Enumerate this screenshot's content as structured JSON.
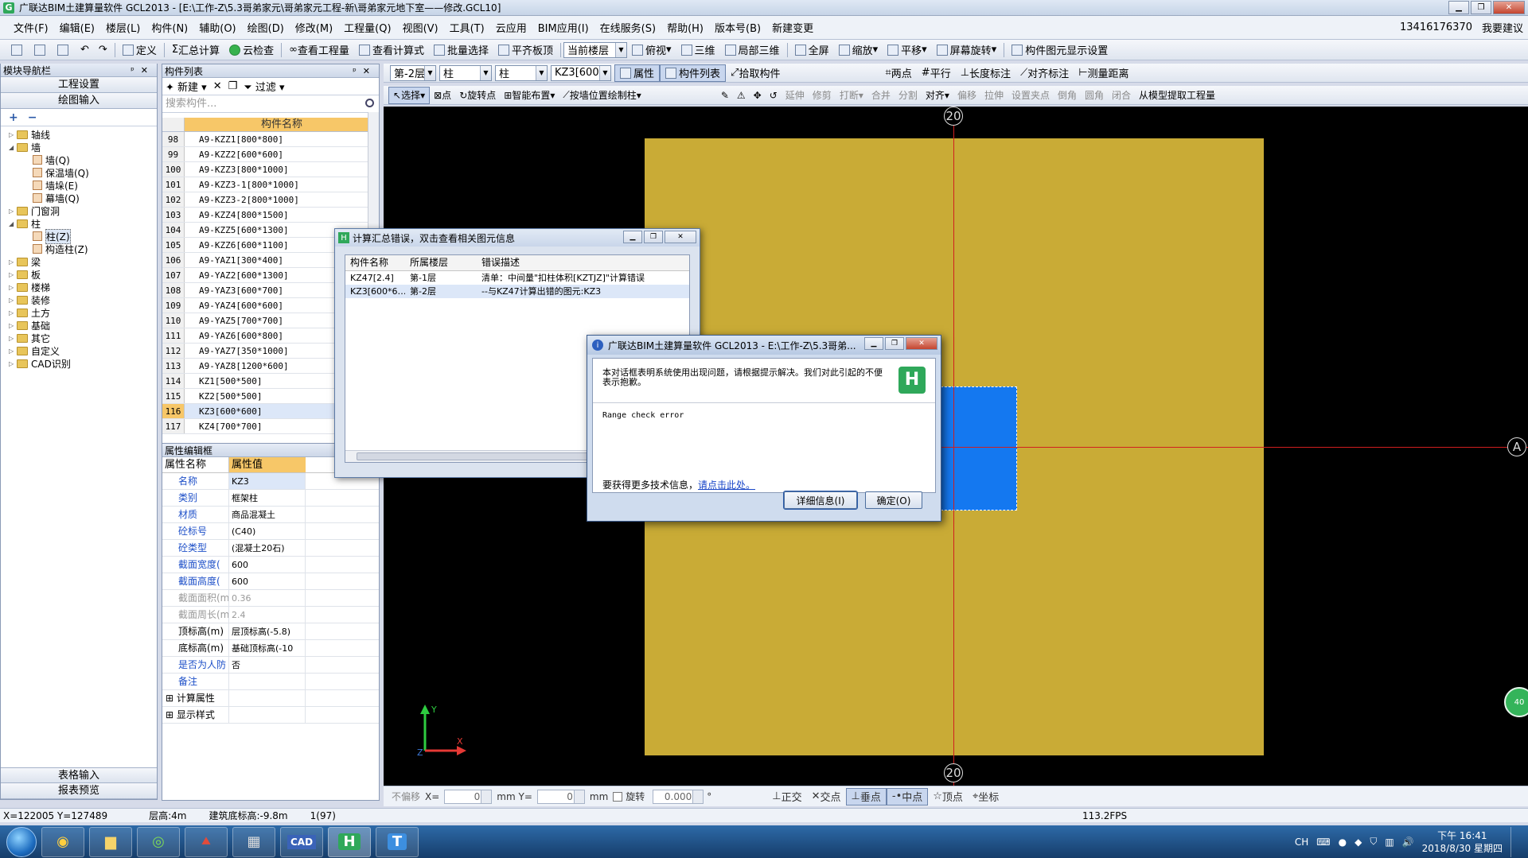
{
  "window": {
    "title": "广联达BIM土建算量软件 GCL2013 - [E:\\工作-Z\\5.3哥弟家元\\哥弟家元工程-新\\哥弟家元地下室——修改.GCL10]",
    "app_icon": "G"
  },
  "menu": [
    "文件(F)",
    "编辑(E)",
    "楼层(L)",
    "构件(N)",
    "辅助(O)",
    "绘图(D)",
    "修改(M)",
    "工程量(Q)",
    "视图(V)",
    "工具(T)",
    "云应用",
    "BIM应用(I)",
    "在线服务(S)",
    "帮助(H)",
    "版本号(B)",
    "新建变更"
  ],
  "account": {
    "phone": "13416176370",
    "suggest": "我要建议"
  },
  "toolbar1": [
    "定义",
    "汇总计算",
    "云检查",
    "查看工程量",
    "查看计算式",
    "批量选择",
    "平齐板顶",
    "当前楼层",
    "俯视",
    "三维",
    "局部三维",
    "全屏",
    "缩放",
    "平移",
    "屏幕旋转",
    "构件图元显示设置"
  ],
  "leftnav": {
    "title": "模块导航栏",
    "top_buttons": [
      "工程设置",
      "绘图输入"
    ],
    "tree": [
      {
        "label": "轴线",
        "level": 0,
        "type": "folder",
        "exp": "▷"
      },
      {
        "label": "墙",
        "level": 0,
        "type": "folder",
        "exp": "◢"
      },
      {
        "label": "墙(Q)",
        "level": 1,
        "type": "leaf"
      },
      {
        "label": "保温墙(Q)",
        "level": 1,
        "type": "leaf"
      },
      {
        "label": "墙垛(E)",
        "level": 1,
        "type": "leaf"
      },
      {
        "label": "幕墙(Q)",
        "level": 1,
        "type": "leaf"
      },
      {
        "label": "门窗洞",
        "level": 0,
        "type": "folder",
        "exp": "▷"
      },
      {
        "label": "柱",
        "level": 0,
        "type": "folder",
        "exp": "◢"
      },
      {
        "label": "柱(Z)",
        "level": 1,
        "type": "leaf",
        "selected": true
      },
      {
        "label": "构造柱(Z)",
        "level": 1,
        "type": "leaf"
      },
      {
        "label": "梁",
        "level": 0,
        "type": "folder",
        "exp": "▷"
      },
      {
        "label": "板",
        "level": 0,
        "type": "folder",
        "exp": "▷"
      },
      {
        "label": "楼梯",
        "level": 0,
        "type": "folder",
        "exp": "▷"
      },
      {
        "label": "装修",
        "level": 0,
        "type": "folder",
        "exp": "▷"
      },
      {
        "label": "土方",
        "level": 0,
        "type": "folder",
        "exp": "▷"
      },
      {
        "label": "基础",
        "level": 0,
        "type": "folder",
        "exp": "▷"
      },
      {
        "label": "其它",
        "level": 0,
        "type": "folder",
        "exp": "▷"
      },
      {
        "label": "自定义",
        "level": 0,
        "type": "folder",
        "exp": "▷"
      },
      {
        "label": "CAD识别",
        "level": 0,
        "type": "folder",
        "exp": "▷"
      }
    ],
    "bottom_buttons": [
      "表格输入",
      "报表预览"
    ]
  },
  "complist": {
    "title": "构件列表",
    "tools": [
      "新建",
      "过滤"
    ],
    "search_placeholder": "搜索构件...",
    "column": "构件名称",
    "rows": [
      {
        "num": "98",
        "name": "A9-KZZ1[800*800]"
      },
      {
        "num": "99",
        "name": "A9-KZZ2[600*600]"
      },
      {
        "num": "100",
        "name": "A9-KZZ3[800*1000]"
      },
      {
        "num": "101",
        "name": "A9-KZZ3-1[800*1000]"
      },
      {
        "num": "102",
        "name": "A9-KZZ3-2[800*1000]"
      },
      {
        "num": "103",
        "name": "A9-KZZ4[800*1500]"
      },
      {
        "num": "104",
        "name": "A9-KZZ5[600*1300]"
      },
      {
        "num": "105",
        "name": "A9-KZZ6[600*1100]"
      },
      {
        "num": "106",
        "name": "A9-YAZ1[300*400]"
      },
      {
        "num": "107",
        "name": "A9-YAZ2[600*1300]"
      },
      {
        "num": "108",
        "name": "A9-YAZ3[600*700]"
      },
      {
        "num": "109",
        "name": "A9-YAZ4[600*600]"
      },
      {
        "num": "110",
        "name": "A9-YAZ5[700*700]"
      },
      {
        "num": "111",
        "name": "A9-YAZ6[600*800]"
      },
      {
        "num": "112",
        "name": "A9-YAZ7[350*1000]"
      },
      {
        "num": "113",
        "name": "A9-YAZ8[1200*600]"
      },
      {
        "num": "114",
        "name": "KZ1[500*500]"
      },
      {
        "num": "115",
        "name": "KZ2[500*500]"
      },
      {
        "num": "116",
        "name": "KZ3[600*600]",
        "selected": true
      },
      {
        "num": "117",
        "name": "KZ4[700*700]"
      }
    ]
  },
  "propedit": {
    "title": "属性编辑框",
    "col_name": "属性名称",
    "col_value": "属性值",
    "rows": [
      {
        "name": "名称",
        "value": "KZ3",
        "style": "blue",
        "hl": true
      },
      {
        "name": "类别",
        "value": "框架柱",
        "style": "blue"
      },
      {
        "name": "材质",
        "value": "商品混凝土",
        "style": "blue"
      },
      {
        "name": "砼标号",
        "value": "(C40)",
        "style": "blue"
      },
      {
        "name": "砼类型",
        "value": "(混凝土20石)",
        "style": "blue"
      },
      {
        "name": "截面宽度(",
        "value": "600",
        "style": "blue"
      },
      {
        "name": "截面高度(",
        "value": "600",
        "style": "blue"
      },
      {
        "name": "截面面积(m",
        "value": "0.36",
        "style": "gray"
      },
      {
        "name": "截面周长(m",
        "value": "2.4",
        "style": "gray"
      },
      {
        "name": "顶标高(m)",
        "value": "层顶标高(-5.8)",
        "style": ""
      },
      {
        "name": "底标高(m)",
        "value": "基础顶标高(-10",
        "style": ""
      },
      {
        "name": "是否为人防",
        "value": "否",
        "style": "blue"
      },
      {
        "name": "备注",
        "value": "",
        "style": "blue"
      },
      {
        "name": "计算属性",
        "value": "",
        "style": "expand"
      },
      {
        "name": "显示样式",
        "value": "",
        "style": "expand"
      }
    ]
  },
  "drawtb": {
    "floor": "第-2层",
    "type1": "柱",
    "type2": "柱",
    "component": "KZ3[600*",
    "items": [
      "属性",
      "构件列表",
      "拾取构件",
      "两点",
      "平行",
      "长度标注",
      "对齐标注",
      "测量距离"
    ]
  },
  "drawtb2": [
    "选择",
    "点",
    "旋转点",
    "智能布置",
    "按墙位置绘制柱",
    "延伸",
    "修剪",
    "打断",
    "合并",
    "分割",
    "对齐",
    "偏移",
    "拉伸",
    "设置夹点",
    "倒角",
    "圆角",
    "闭合",
    "从模型提取工程量"
  ],
  "canvas": {
    "axis_top": "20",
    "axis_bottom": "20",
    "axis_right": "A",
    "bubble_badge": "40"
  },
  "coordbar": {
    "offset": "不偏移",
    "x_label": "X=",
    "x_val": "0",
    "y_label": "mm Y=",
    "y_val": "0",
    "unit": "mm",
    "rotate": "旋转",
    "angle": "0.000",
    "degree": "°",
    "snaps": [
      "正交",
      "交点",
      "垂点",
      "中点",
      "顶点",
      "坐标"
    ]
  },
  "statusbar": {
    "coords": "X=122005 Y=127489",
    "height": "层高:4m",
    "base": "建筑底标高:-9.8m",
    "count": "1(97)",
    "fps": "113.2FPS"
  },
  "errdlg": {
    "title": "计算汇总错误，双击查看相关图元信息",
    "headers": [
      "构件名称",
      "所属楼层",
      "错误描述"
    ],
    "rows": [
      {
        "c1": "KZ47[2.4]",
        "c2": "第-1层",
        "c3": "清单：中间量\"扣柱体积[KZTJZ]\"计算错误"
      },
      {
        "c1": "KZ3[600*6…",
        "c2": "第-2层",
        "c3": "--与KZ47计算出错的图元:KZ3",
        "selected": true
      }
    ]
  },
  "msgdlg": {
    "title": "广联达BIM土建算量软件 GCL2013 - E:\\工作-Z\\5.3哥弟...",
    "intro": "本对话框表明系统使用出现问题，请根据提示解决。我们对此引起的不便表示抱歉。",
    "error": "Range check error",
    "more_prefix": "要获得更多技术信息，",
    "more_link": "请点击此处。",
    "btn_detail": "详细信息(I)",
    "btn_ok": "确定(O)"
  },
  "taskbar": {
    "tray_lang": "CH",
    "time": "下午 16:41",
    "date": "2018/8/30 星期四"
  }
}
